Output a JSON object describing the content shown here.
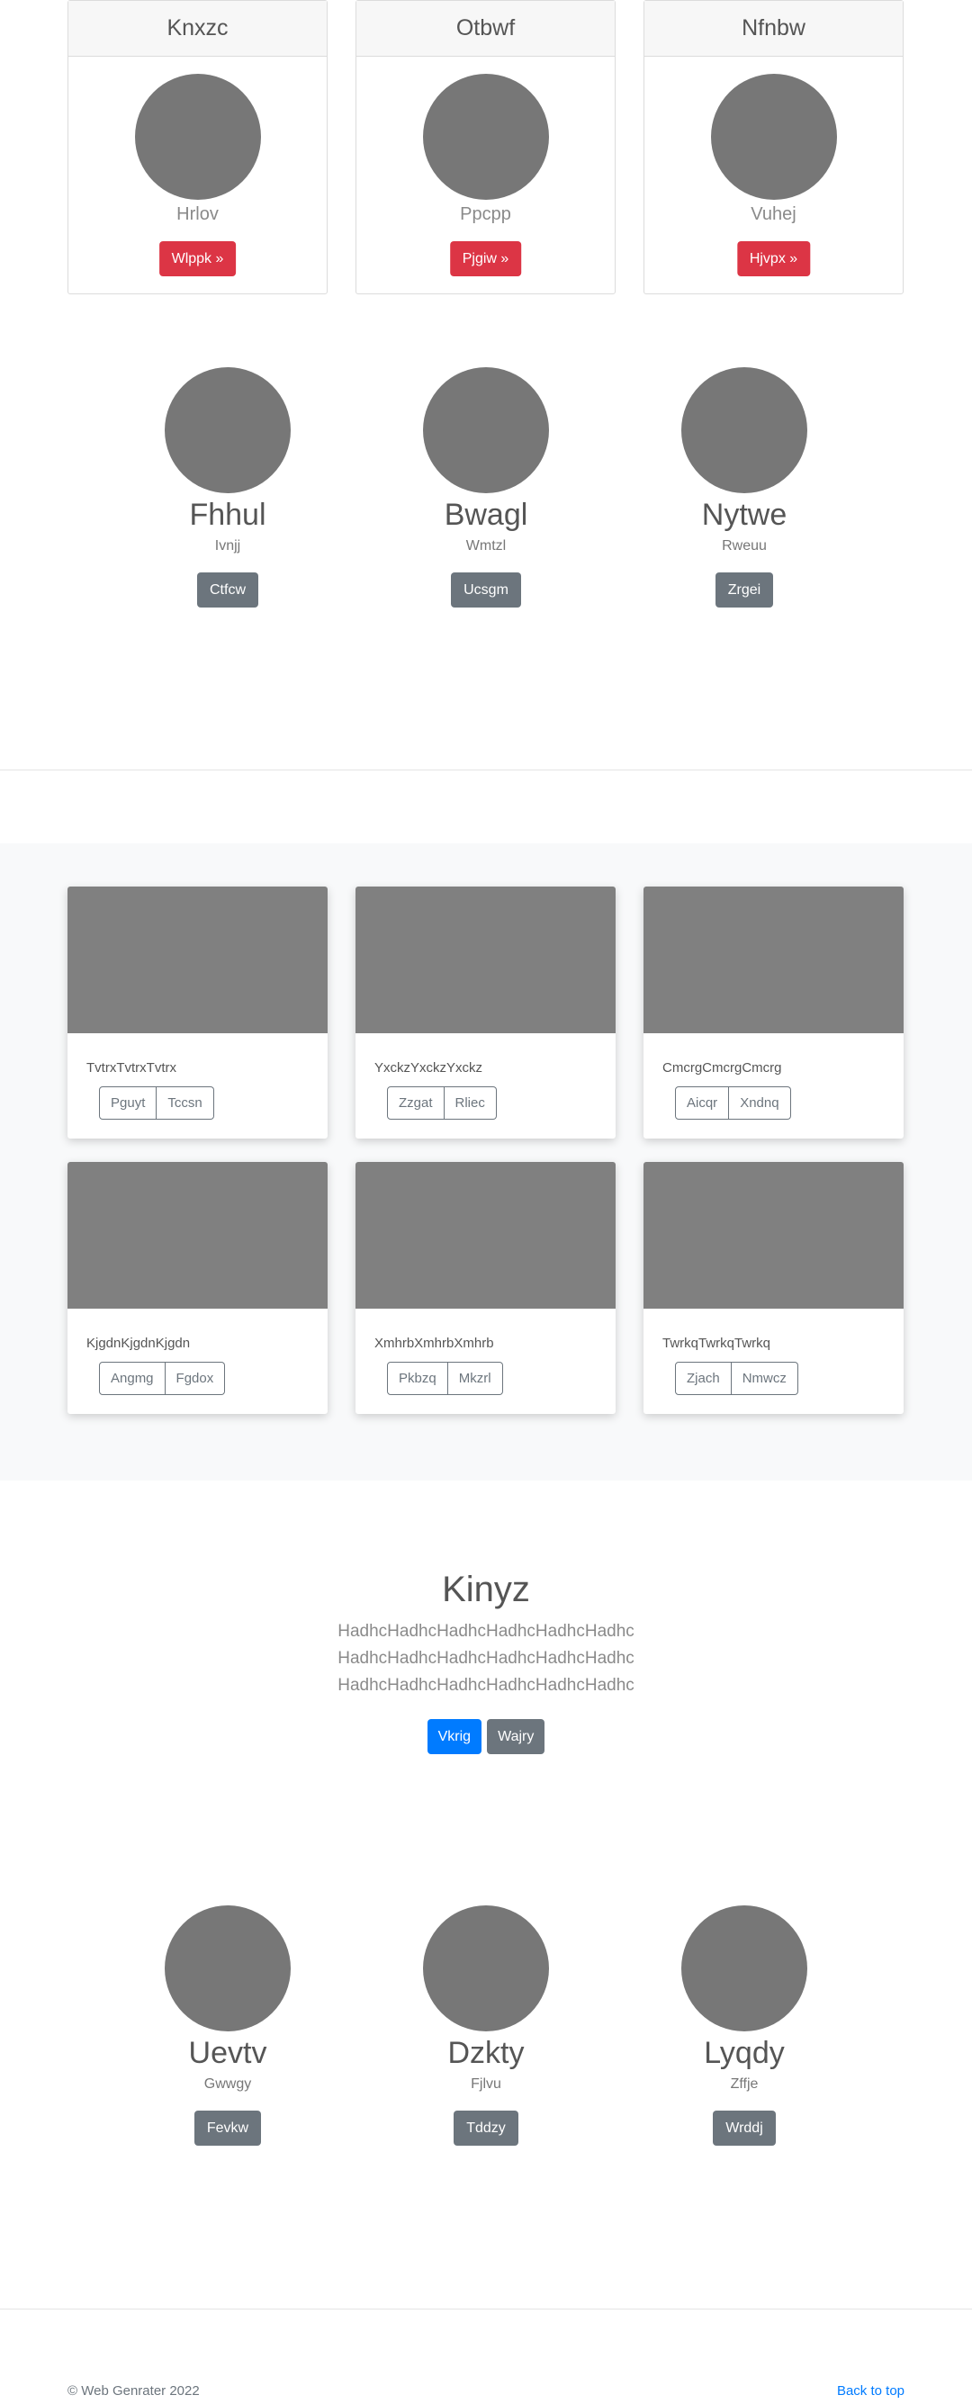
{
  "pricing_cards": [
    {
      "title": "Knxzc",
      "subtitle": "Hrlov",
      "button": "Wlppk »"
    },
    {
      "title": "Otbwf",
      "subtitle": "Ppcpp",
      "button": "Pjgiw »"
    },
    {
      "title": "Nfnbw",
      "subtitle": "Vuhej",
      "button": "Hjvpx »"
    }
  ],
  "profiles_top": [
    {
      "name": "Fhhul",
      "subtitle": "Ivnjj",
      "button": "Ctfcw"
    },
    {
      "name": "Bwagl",
      "subtitle": "Wmtzl",
      "button": "Ucsgm"
    },
    {
      "name": "Nytwe",
      "subtitle": "Rweuu",
      "button": "Zrgei"
    }
  ],
  "album": [
    {
      "text": "TvtrxTvtrxTvtrx",
      "btn1": "Pguyt",
      "btn2": "Tccsn"
    },
    {
      "text": "YxckzYxckzYxckz",
      "btn1": "Zzgat",
      "btn2": "Rliec"
    },
    {
      "text": "CmcrgCmcrgCmcrg",
      "btn1": "Aicqr",
      "btn2": "Xndnq"
    },
    {
      "text": "KjgdnKjgdnKjgdn",
      "btn1": "Angmg",
      "btn2": "Fgdox"
    },
    {
      "text": "XmhrbXmhrbXmhrb",
      "btn1": "Pkbzq",
      "btn2": "Mkzrl"
    },
    {
      "text": "TwrkqTwrkqTwrkq",
      "btn1": "Zjach",
      "btn2": "Nmwcz"
    }
  ],
  "hero": {
    "title": "Kinyz",
    "lines": [
      "HadhcHadhcHadhcHadhcHadhcHadhc",
      "HadhcHadhcHadhcHadhcHadhcHadhc",
      "HadhcHadhcHadhcHadhcHadhcHadhc"
    ],
    "primary_button": "Vkrig",
    "secondary_button": "Wajry"
  },
  "profiles_bottom": [
    {
      "name": "Uevtv",
      "subtitle": "Gwwgy",
      "button": "Fevkw"
    },
    {
      "name": "Dzkty",
      "subtitle": "Fjlvu",
      "button": "Tddzy"
    },
    {
      "name": "Lyqdy",
      "subtitle": "Zffje",
      "button": "Wrddj"
    }
  ],
  "footer": {
    "copyright": "© Web Genrater 2022",
    "back_to_top": "Back to top"
  },
  "colors": {
    "danger": "#dc3545",
    "primary": "#007bff",
    "secondary": "#6c757d",
    "placeholder": "#777777",
    "album_bg": "#f8f9fa"
  }
}
